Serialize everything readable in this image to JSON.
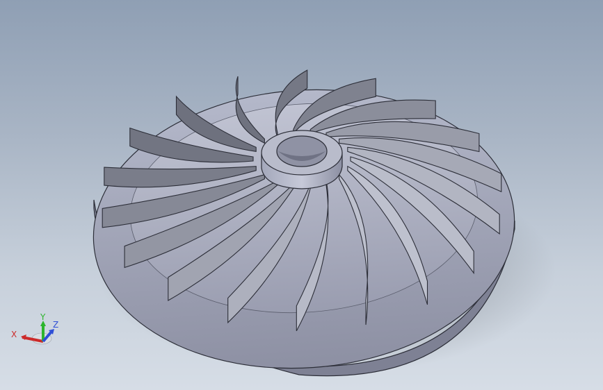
{
  "viewport": {
    "model_name": "impeller-3d-model",
    "blade_count": 18,
    "colors": {
      "background_top": "#8f9fb4",
      "background_bottom": "#d6dde6",
      "part_face": "#a8acbf",
      "part_shadow": "#6e7285",
      "edge": "#2c2e38"
    }
  },
  "triad": {
    "x_label": "X",
    "y_label": "Y",
    "z_label": "Z",
    "x_color": "#cc2a2a",
    "y_color": "#2db52d",
    "z_color": "#2f4fd6"
  }
}
